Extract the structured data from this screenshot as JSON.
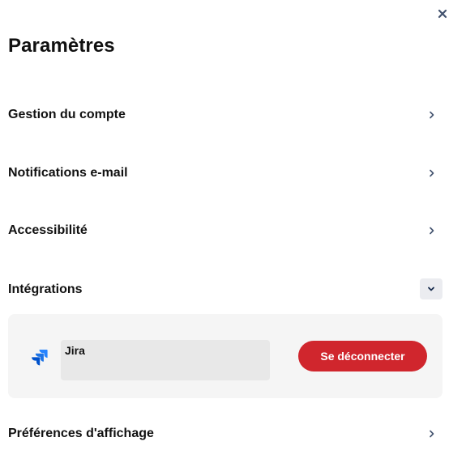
{
  "settings": {
    "title": "Paramètres",
    "close_icon": "close-icon",
    "items": [
      {
        "label": "Gestion du compte",
        "icon": "chevron-right-icon"
      },
      {
        "label": "Notifications e-mail",
        "icon": "chevron-right-icon"
      },
      {
        "label": "Accessibilité",
        "icon": "chevron-right-icon"
      },
      {
        "label": "Intégrations",
        "icon": "chevron-down-icon",
        "expanded": true
      },
      {
        "label": "Préférences d'affichage",
        "icon": "chevron-right-icon"
      }
    ],
    "integrations": [
      {
        "name": "Jira",
        "icon": "jira-logo",
        "action_label": "Se déconnecter"
      }
    ]
  },
  "colors": {
    "disconnect_button": "#d0262d",
    "panel_background": "#f5f5f5",
    "jira_blue": "#2684ff"
  }
}
